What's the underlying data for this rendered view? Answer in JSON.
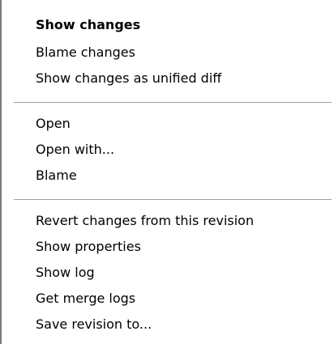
{
  "menu": {
    "groups": [
      {
        "items": [
          {
            "label": "Show changes",
            "bold": true
          },
          {
            "label": "Blame changes",
            "bold": false
          },
          {
            "label": "Show changes as unified diff",
            "bold": false
          }
        ]
      },
      {
        "items": [
          {
            "label": "Open",
            "bold": false
          },
          {
            "label": "Open with...",
            "bold": false
          },
          {
            "label": "Blame",
            "bold": false
          }
        ]
      },
      {
        "items": [
          {
            "label": "Revert changes from this revision",
            "bold": false
          },
          {
            "label": "Show properties",
            "bold": false
          },
          {
            "label": "Show log",
            "bold": false
          },
          {
            "label": "Get merge logs",
            "bold": false
          },
          {
            "label": "Save revision to...",
            "bold": false
          }
        ]
      }
    ]
  }
}
